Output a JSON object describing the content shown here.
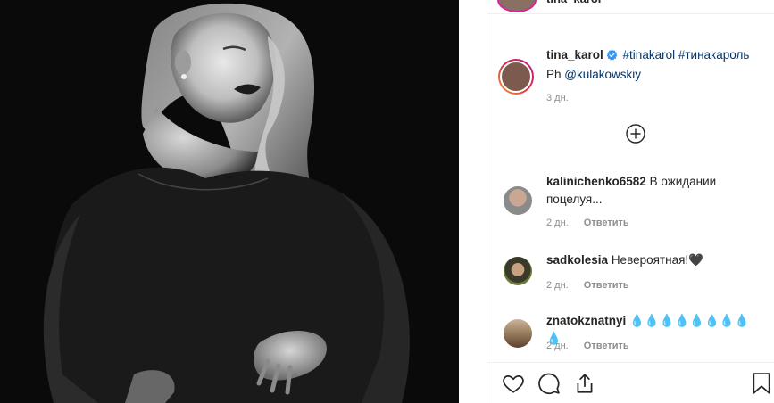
{
  "post_image": {
    "alt": ""
  },
  "top_header": {
    "username": "tina_karol"
  },
  "caption": {
    "username": "tina_karol",
    "hashtags": [
      "#tinakarol",
      "#тинакароль"
    ],
    "ph_prefix": "Ph",
    "mention": "@kulakowskiy",
    "time": "3 дн."
  },
  "comments": [
    {
      "username": "kalinichenko6582",
      "text": "В ожидании поцелуя...",
      "time": "2 дн.",
      "reply": "Ответить"
    },
    {
      "username": "sadkolesia",
      "text": "Невероятная!🖤",
      "time": "2 дн.",
      "reply": "Ответить"
    },
    {
      "username": "znatokznatnyi",
      "text": "💧💧💧💧💧💧💧💧💧",
      "time": "2 дн.",
      "reply": "Ответить"
    }
  ],
  "colors": {
    "link": "#003569",
    "verified": "#3897f0",
    "muted": "#8e8e8e"
  }
}
